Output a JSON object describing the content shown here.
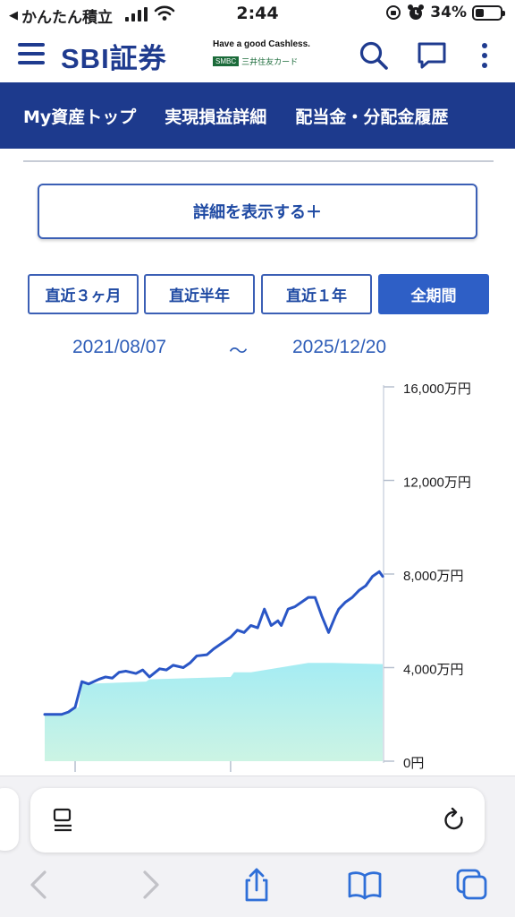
{
  "status_bar": {
    "back_label": "かんたん積立",
    "time": "2:44",
    "battery": "34%",
    "battery_level": 0.34
  },
  "header": {
    "logo": "SBI証券",
    "tagline": "Have a good Cashless.",
    "smbc_badge": "SMBC",
    "card_name": "三井住友カード"
  },
  "nav": {
    "items": [
      {
        "label": "My資産トップ"
      },
      {
        "label": "実現損益詳細"
      },
      {
        "label": "配当金・分配金履歴"
      }
    ]
  },
  "detail_button": {
    "label": "詳細を表示する＋"
  },
  "period_tabs": [
    {
      "label": "直近３ヶ月",
      "active": false
    },
    {
      "label": "直近半年",
      "active": false
    },
    {
      "label": "直近１年",
      "active": false
    },
    {
      "label": "全期間",
      "active": true
    }
  ],
  "date_range": {
    "start": "2021/08/07",
    "separator": "〜",
    "end": "2025/12/20"
  },
  "chart_data": {
    "type": "area",
    "x_start": "2021/08/07",
    "x_end": "2025/12/20",
    "ylim": [
      0,
      16000
    ],
    "y_ticks": [
      "16,000万円",
      "12,000万円",
      "8,000万円",
      "4,000万円",
      "0円"
    ],
    "y_tick_values": [
      16000,
      12000,
      8000,
      4000,
      0
    ],
    "series": [
      {
        "kind": "line",
        "color": "#2a56c6",
        "x": [
          0.0,
          0.05,
          0.07,
          0.09,
          0.11,
          0.13,
          0.16,
          0.18,
          0.2,
          0.22,
          0.24,
          0.27,
          0.29,
          0.31,
          0.34,
          0.36,
          0.38,
          0.41,
          0.43,
          0.45,
          0.48,
          0.5,
          0.52,
          0.55,
          0.57,
          0.59,
          0.61,
          0.63,
          0.65,
          0.67,
          0.69,
          0.7,
          0.72,
          0.74,
          0.76,
          0.78,
          0.8,
          0.82,
          0.84,
          0.86,
          0.87,
          0.89,
          0.91,
          0.93,
          0.95,
          0.97,
          0.99,
          1.0
        ],
        "values": [
          2000,
          2000,
          2100,
          2300,
          3400,
          3300,
          3500,
          3600,
          3550,
          3800,
          3850,
          3750,
          3900,
          3600,
          3950,
          3900,
          4100,
          4000,
          4200,
          4500,
          4550,
          4800,
          5000,
          5300,
          5600,
          5500,
          5800,
          5700,
          6500,
          5800,
          6000,
          5800,
          6500,
          6600,
          6800,
          7000,
          7000,
          6200,
          5500,
          6200,
          6500,
          6800,
          7000,
          7300,
          7500,
          7900,
          8100,
          7900
        ]
      },
      {
        "kind": "area",
        "colors": [
          "#a5ecf3",
          "#ccf4e4"
        ],
        "x": [
          0.0,
          0.05,
          0.06,
          0.1,
          0.11,
          0.3,
          0.31,
          0.55,
          0.56,
          0.57,
          0.6,
          0.61,
          0.78,
          0.79,
          0.84,
          0.85,
          1.0
        ],
        "values": [
          2000,
          2000,
          2100,
          2300,
          3300,
          3400,
          3500,
          3600,
          3800,
          3800,
          3800,
          3800,
          4200,
          4200,
          4200,
          4200,
          4150
        ]
      }
    ]
  }
}
